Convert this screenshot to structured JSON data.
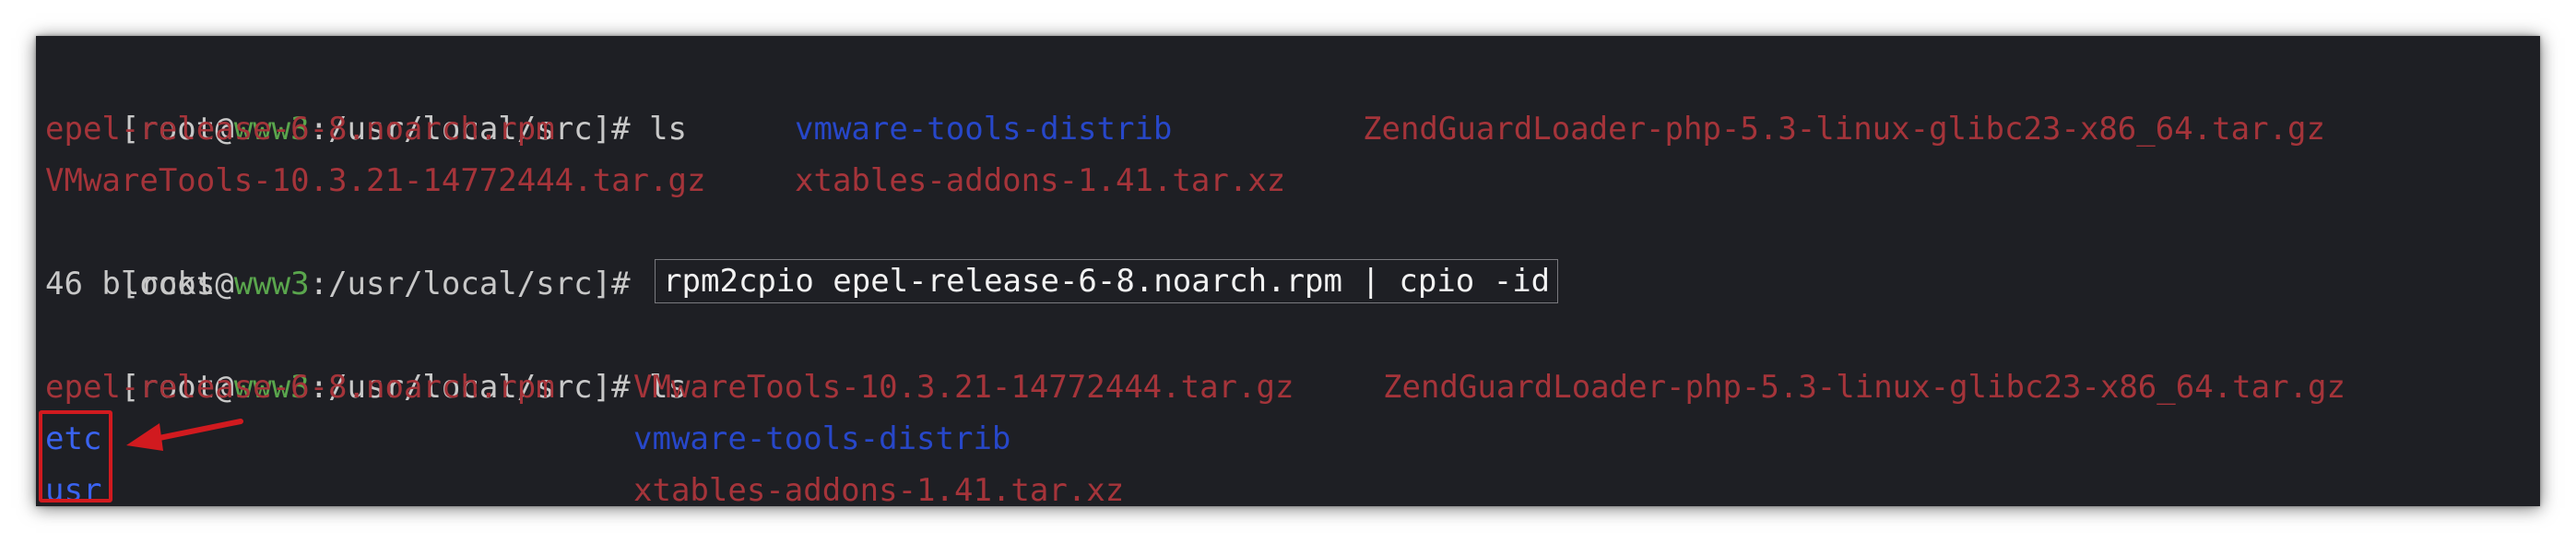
{
  "terminal": {
    "prompt": {
      "open": "[root@",
      "host": "www3",
      "path_suffix": ":/usr/local/src]# "
    },
    "colors": {
      "background": "#1e1f24",
      "host": "#5aa64d",
      "file": "#a5343a",
      "directory": "#2747c9",
      "highlight": "#d11a1f"
    },
    "lines": [
      {
        "type": "command",
        "command": "ls"
      },
      {
        "type": "output",
        "items": [
          "epel-release-6-8.noarch.rpm",
          "vmware-tools-distrib",
          "ZendGuardLoader-php-5.3-linux-glibc23-x86_64.tar.gz"
        ]
      },
      {
        "type": "output",
        "items": [
          "VMwareTools-10.3.21-14772444.tar.gz",
          "xtables-addons-1.41.tar.xz"
        ]
      },
      {
        "type": "command",
        "command": "rpm2cpio epel-release-6-8.noarch.rpm | cpio -id"
      },
      {
        "type": "output",
        "text": "46 blocks"
      },
      {
        "type": "command",
        "command": "ls"
      },
      {
        "type": "output",
        "items": [
          "epel-release-6-8.noarch.rpm",
          "VMwareTools-10.3.21-14772444.tar.gz",
          "ZendGuardLoader-php-5.3-linux-glibc23-x86_64.tar.gz"
        ]
      },
      {
        "type": "output",
        "items": [
          "etc",
          "vmware-tools-distrib"
        ]
      },
      {
        "type": "output",
        "items": [
          "usr",
          "xtables-addons-1.41.tar.xz"
        ]
      }
    ]
  },
  "annotation": {
    "icon": "red-arrow-icon"
  }
}
